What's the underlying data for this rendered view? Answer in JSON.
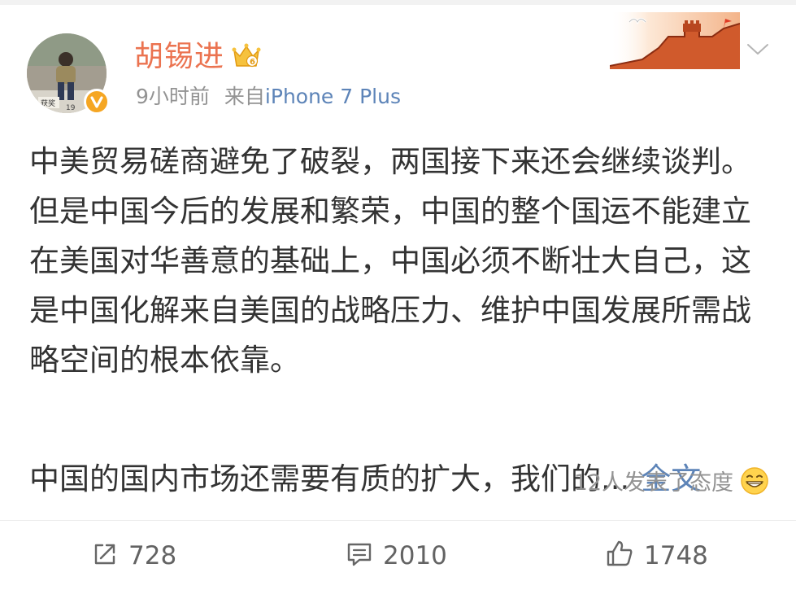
{
  "post": {
    "username": "胡锡进",
    "time": "9小时前",
    "source_prefix": "来自",
    "source": "iPhone 7 Plus",
    "avatar_caption": "19",
    "text_paragraph1": "中美贸易磋商避免了破裂，两国接下来还会继续谈判。但是中国今后的发展和繁荣，中国的整个国运不能建立在美国对华善意的基础上，中国必须不断壮大自己，这是中国化解来自美国的战略压力、维护中国发展所需战略空间的根本依靠。",
    "text_paragraph2": "中国的国内市场还需要有质的扩大，我们的...",
    "more_label": "全文",
    "reactions_text": "12人发表了态度"
  },
  "actions": {
    "repost_count": "728",
    "comment_count": "2010",
    "like_count": "1748"
  },
  "icons": {
    "vip": "crown-icon",
    "verified": "verified-v-icon",
    "menu": "chevron-down-icon",
    "reaction": "grin-emoji-icon",
    "repost": "repost-icon",
    "comment": "comment-icon",
    "like": "thumbs-up-icon"
  },
  "colors": {
    "username": "#eb7350",
    "link": "#5d84b8",
    "meta": "#939393",
    "body_text": "#333333",
    "verified_badge": "#f5a623"
  }
}
